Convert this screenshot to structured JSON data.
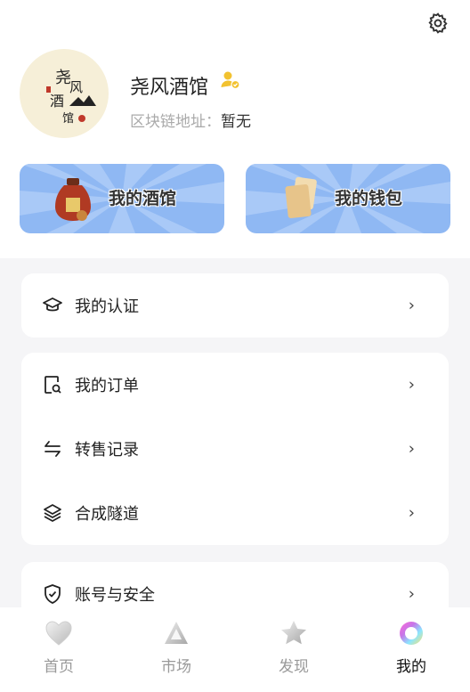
{
  "profile": {
    "name": "尧风酒馆",
    "chain_label": "区块链地址：",
    "chain_value": "暂无",
    "avatar_text": [
      "尧",
      "风",
      "酒",
      "馆"
    ]
  },
  "icons": {
    "settings": "gear-icon",
    "verified": "user-verified-icon"
  },
  "cards": [
    {
      "label": "我的酒馆",
      "icon": "wine-jar-icon"
    },
    {
      "label": "我的钱包",
      "icon": "wallet-cards-icon"
    }
  ],
  "menu": {
    "group1": [
      {
        "label": "我的认证",
        "icon": "graduation-cap-icon"
      }
    ],
    "group2": [
      {
        "label": "我的订单",
        "icon": "order-search-icon"
      },
      {
        "label": "转售记录",
        "icon": "transfer-icon"
      },
      {
        "label": "合成隧道",
        "icon": "layers-icon"
      }
    ],
    "group3": [
      {
        "label": "账号与安全",
        "icon": "shield-check-icon"
      }
    ],
    "chevron": "›"
  },
  "tabs": [
    {
      "label": "首页",
      "icon": "heart-icon",
      "active": false
    },
    {
      "label": "市场",
      "icon": "triangle-icon",
      "active": false
    },
    {
      "label": "发现",
      "icon": "star-icon",
      "active": false
    },
    {
      "label": "我的",
      "icon": "orb-icon",
      "active": true
    }
  ],
  "colors": {
    "card_bg": "#8fb8f3",
    "badge": "#f2c230",
    "active_tab": "#111111",
    "inactive_tab": "#999999"
  }
}
